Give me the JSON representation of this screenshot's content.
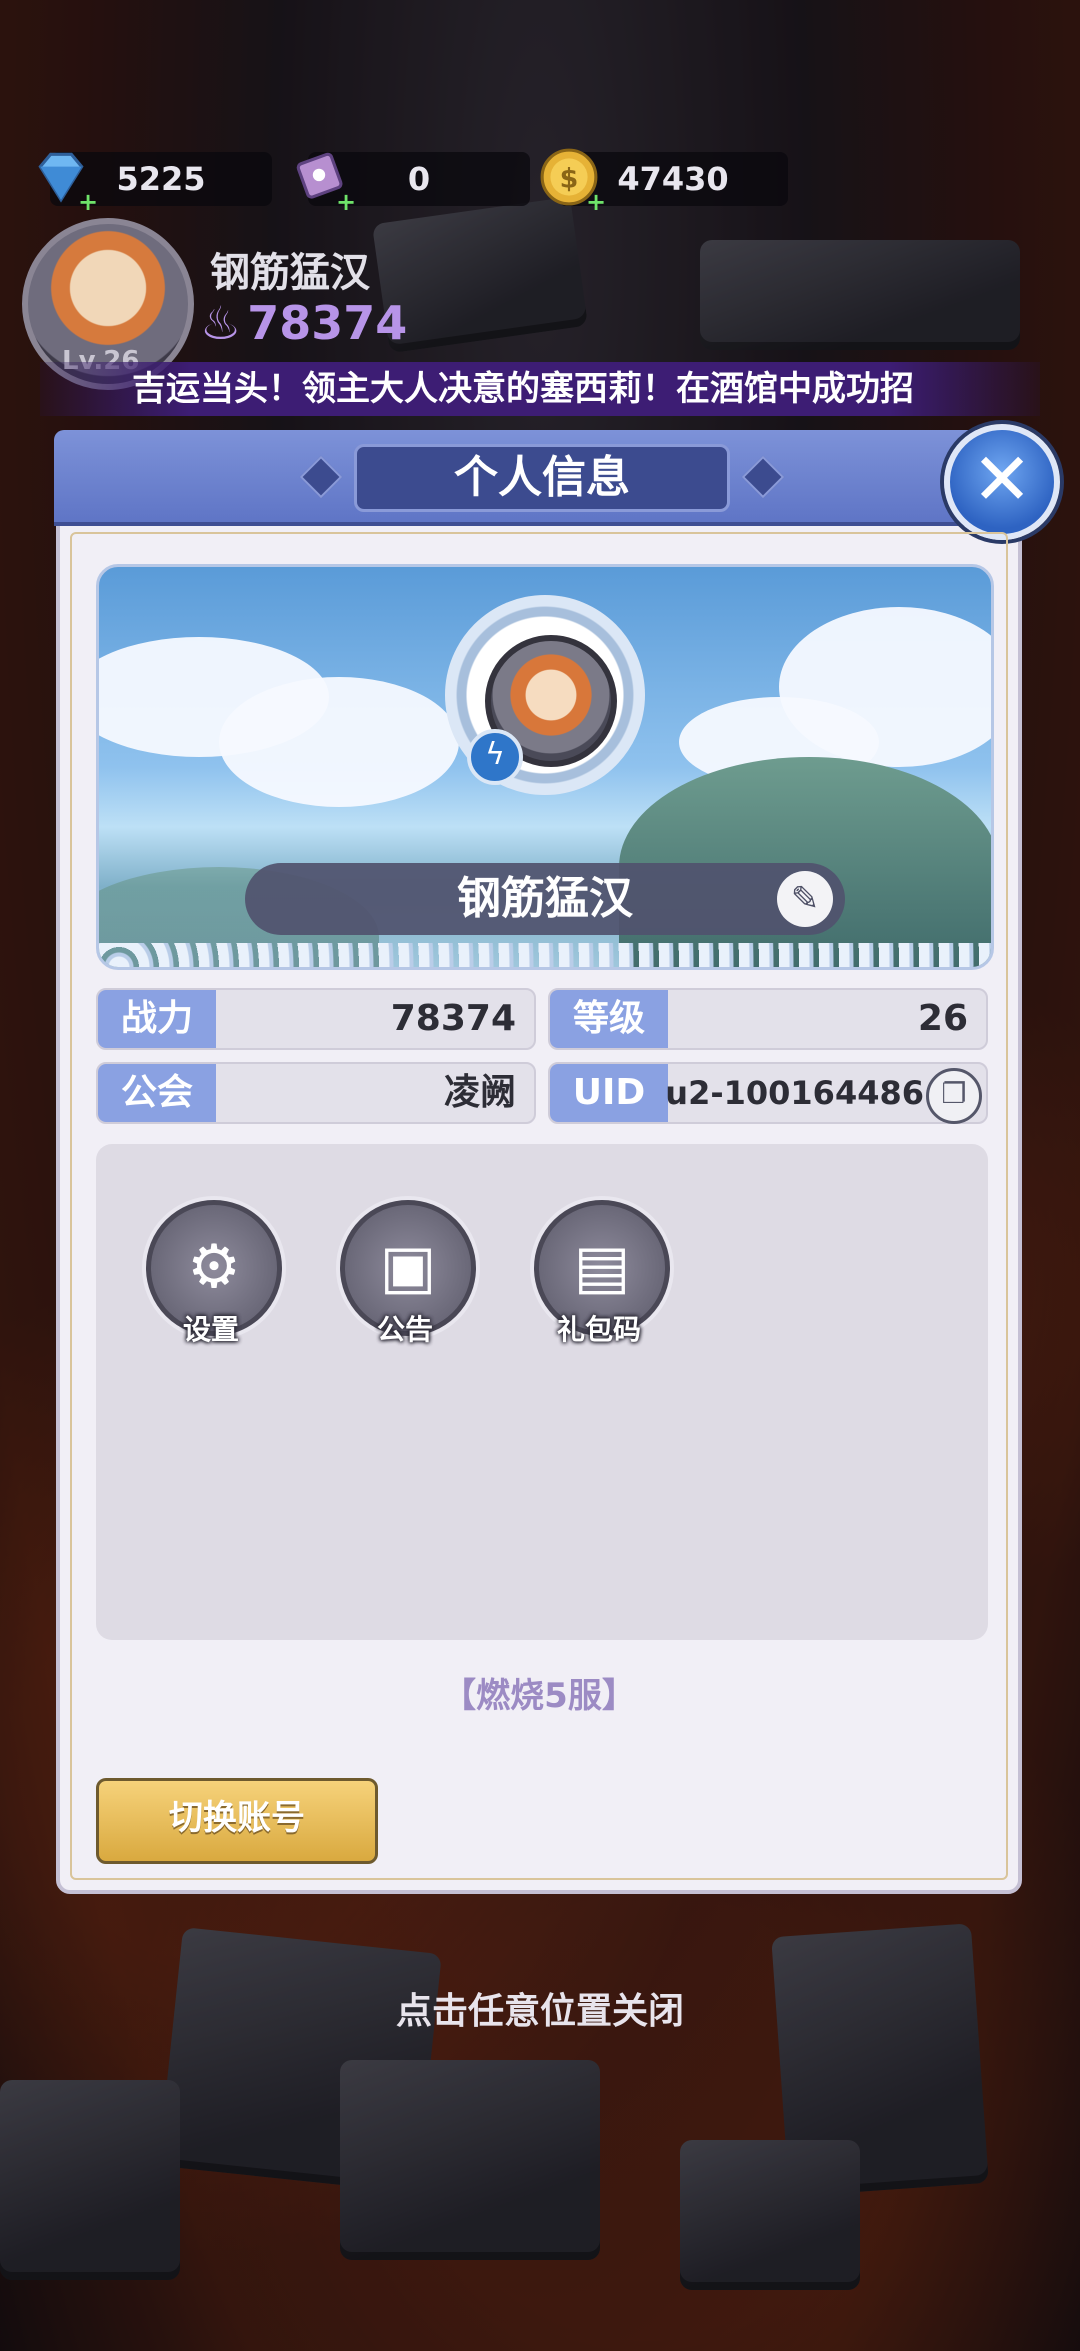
{
  "resources": [
    {
      "icon": "diamond-icon",
      "value": "5225"
    },
    {
      "icon": "ticket-icon",
      "value": "0"
    },
    {
      "icon": "gold-coin-icon",
      "value": "47430"
    }
  ],
  "player": {
    "name": "钢筋猛汉",
    "power": "78374",
    "level_label": "Lv.26"
  },
  "marquee": "吉运当头！领主大人决意的塞西莉！在酒馆中成功招",
  "dialog": {
    "title": "个人信息",
    "name": "钢筋猛汉",
    "stats": [
      {
        "label": "战力",
        "value": "78374"
      },
      {
        "label": "等级",
        "value": "26"
      },
      {
        "label": "公会",
        "value": "凌阙"
      },
      {
        "label": "UID",
        "value": "u2-100164486"
      }
    ],
    "functions": [
      {
        "label": "设置",
        "icon": "gear-icon"
      },
      {
        "label": "公告",
        "icon": "notice-board-icon"
      },
      {
        "label": "礼包码",
        "icon": "gift-code-icon"
      }
    ],
    "server": "【燃烧5服】",
    "switch_account": "切换账号"
  },
  "close_hint": "点击任意位置关闭",
  "colors": {
    "header": "#6f84d0",
    "label_bg": "#8aa1e2",
    "gold_button": "#e8bd5a",
    "server_text": "#9c8bc4"
  }
}
